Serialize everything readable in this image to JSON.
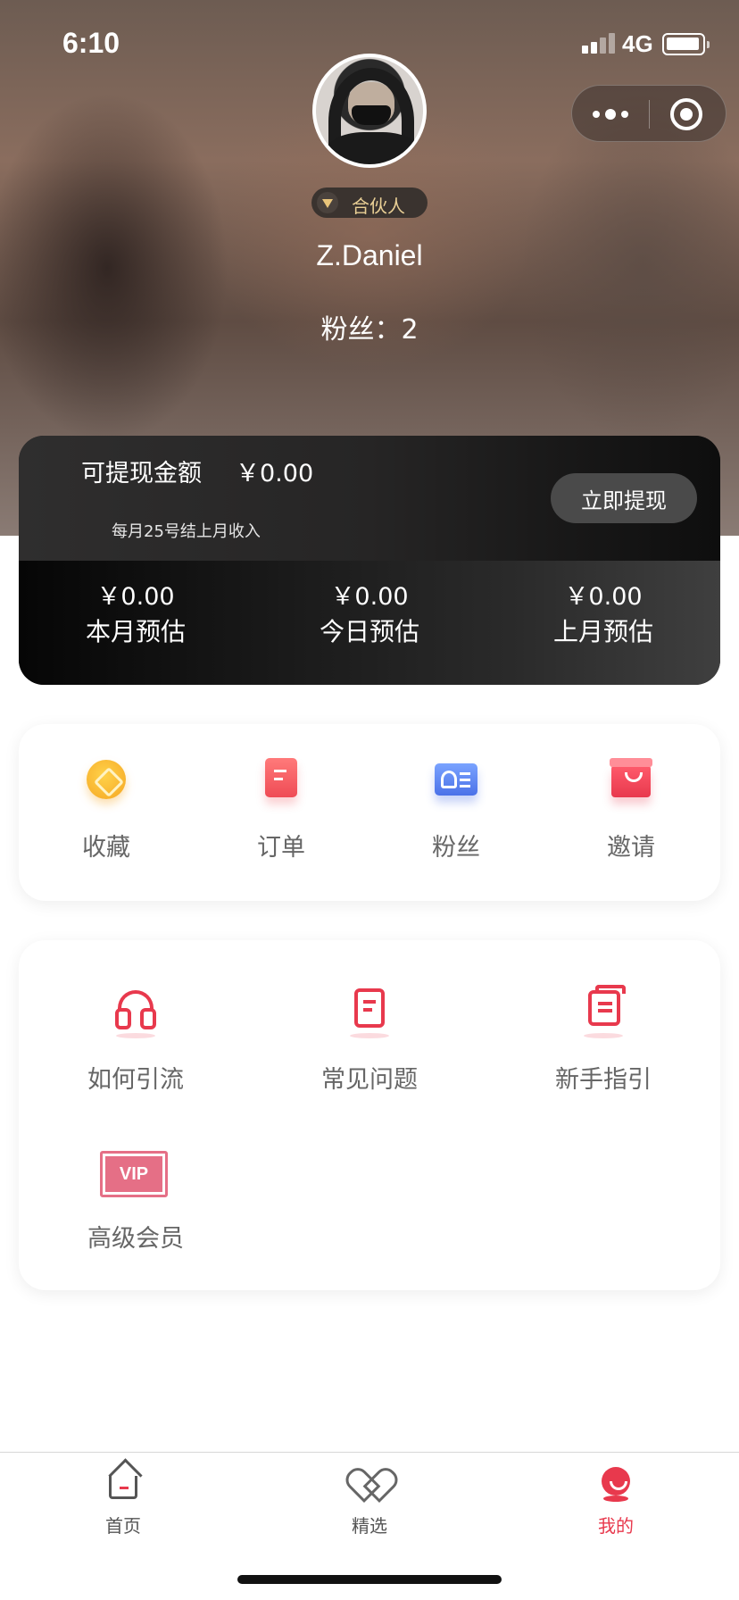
{
  "status_bar": {
    "time": "6:10",
    "network": "4G",
    "signal_bars_active": 2,
    "signal_bars_total": 4
  },
  "capsule": {
    "more_icon": "more-dots-icon",
    "close_icon": "target-close-icon"
  },
  "profile": {
    "avatar_icon": "avatar",
    "role": "合伙人",
    "name": "Z.Daniel",
    "fans_line": "粉丝：2"
  },
  "earnings": {
    "withdrawable_label": "可提现金额",
    "withdrawable_amount": "￥0.00",
    "settle_note": "每月25号结上月收入",
    "withdraw_button": "立即提现",
    "stats": [
      {
        "value": "￥0.00",
        "label": "本月预估"
      },
      {
        "value": "￥0.00",
        "label": "今日预估"
      },
      {
        "value": "￥0.00",
        "label": "上月预估"
      }
    ]
  },
  "quick_actions": [
    {
      "label": "收藏",
      "icon": "favorite-coin-icon"
    },
    {
      "label": "订单",
      "icon": "order-document-icon"
    },
    {
      "label": "粉丝",
      "icon": "fans-id-card-icon"
    },
    {
      "label": "邀请",
      "icon": "invite-gift-icon"
    }
  ],
  "help_items": [
    {
      "label": "如何引流",
      "icon": "headset-icon"
    },
    {
      "label": "常见问题",
      "icon": "faq-document-icon"
    },
    {
      "label": "新手指引",
      "icon": "guide-document-icon"
    },
    {
      "label": "高级会员",
      "icon": "vip-badge-icon",
      "badge_text": "VIP"
    }
  ],
  "tab_bar": {
    "items": [
      {
        "label": "首页",
        "icon": "home-icon",
        "active": false
      },
      {
        "label": "精选",
        "icon": "heart-icon",
        "active": false
      },
      {
        "label": "我的",
        "icon": "me-icon",
        "active": true
      }
    ]
  },
  "colors": {
    "accent": "#e8394d",
    "gold": "#e9cf95",
    "card_dark": "#141414"
  }
}
